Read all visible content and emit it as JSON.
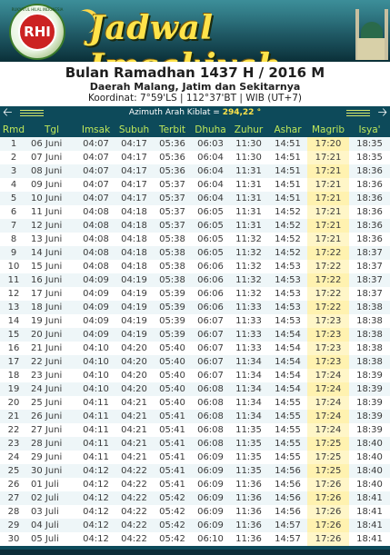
{
  "header": {
    "logo_text": "RHI",
    "logo_ring_text": "RUKYATUL HILAL INDONESIA",
    "brand": "Jadwal Imsakiyah"
  },
  "titlebox": {
    "title": "Bulan Ramadhan 1437 H / 2016 M",
    "subtitle": "Daerah Malang, Jatim dan Sekitarnya",
    "coords": "Koordinat: 7°59'LS | 112°37'BT | WIB (UT+7)"
  },
  "kiblat": {
    "label": "Azimuth Arah Kiblat = ",
    "value": "294,22 °"
  },
  "table": {
    "headers": [
      "Rmd",
      "Tgl",
      "Imsak",
      "Subuh",
      "Terbit",
      "Dhuha",
      "Zuhur",
      "Ashar",
      "Magrib",
      "Isya'"
    ],
    "rows": [
      [
        "1",
        "06 Juni",
        "04:07",
        "04:17",
        "05:36",
        "06:03",
        "11:30",
        "14:51",
        "17:20",
        "18:35"
      ],
      [
        "2",
        "07 Juni",
        "04:07",
        "04:17",
        "05:36",
        "06:04",
        "11:30",
        "14:51",
        "17:21",
        "18:35"
      ],
      [
        "3",
        "08 Juni",
        "04:07",
        "04:17",
        "05:36",
        "06:04",
        "11:31",
        "14:51",
        "17:21",
        "18:36"
      ],
      [
        "4",
        "09 Juni",
        "04:07",
        "04:17",
        "05:37",
        "06:04",
        "11:31",
        "14:51",
        "17:21",
        "18:36"
      ],
      [
        "5",
        "10 Juni",
        "04:07",
        "04:17",
        "05:37",
        "06:04",
        "11:31",
        "14:51",
        "17:21",
        "18:36"
      ],
      [
        "6",
        "11 Juni",
        "04:08",
        "04:18",
        "05:37",
        "06:05",
        "11:31",
        "14:52",
        "17:21",
        "18:36"
      ],
      [
        "7",
        "12 Juni",
        "04:08",
        "04:18",
        "05:37",
        "06:05",
        "11:31",
        "14:52",
        "17:21",
        "18:36"
      ],
      [
        "8",
        "13 Juni",
        "04:08",
        "04:18",
        "05:38",
        "06:05",
        "11:32",
        "14:52",
        "17:21",
        "18:36"
      ],
      [
        "9",
        "14 Juni",
        "04:08",
        "04:18",
        "05:38",
        "06:05",
        "11:32",
        "14:52",
        "17:22",
        "18:37"
      ],
      [
        "10",
        "15 Juni",
        "04:08",
        "04:18",
        "05:38",
        "06:06",
        "11:32",
        "14:53",
        "17:22",
        "18:37"
      ],
      [
        "11",
        "16 Juni",
        "04:09",
        "04:19",
        "05:38",
        "06:06",
        "11:32",
        "14:53",
        "17:22",
        "18:37"
      ],
      [
        "12",
        "17 Juni",
        "04:09",
        "04:19",
        "05:39",
        "06:06",
        "11:32",
        "14:53",
        "17:22",
        "18:37"
      ],
      [
        "13",
        "18 Juni",
        "04:09",
        "04:19",
        "05:39",
        "06:06",
        "11:33",
        "14:53",
        "17:22",
        "18:38"
      ],
      [
        "14",
        "19 Juni",
        "04:09",
        "04:19",
        "05:39",
        "06:07",
        "11:33",
        "14:53",
        "17:23",
        "18:38"
      ],
      [
        "15",
        "20 Juni",
        "04:09",
        "04:19",
        "05:39",
        "06:07",
        "11:33",
        "14:54",
        "17:23",
        "18:38"
      ],
      [
        "16",
        "21 Juni",
        "04:10",
        "04:20",
        "05:40",
        "06:07",
        "11:33",
        "14:54",
        "17:23",
        "18:38"
      ],
      [
        "17",
        "22 Juni",
        "04:10",
        "04:20",
        "05:40",
        "06:07",
        "11:34",
        "14:54",
        "17:23",
        "18:38"
      ],
      [
        "18",
        "23 Juni",
        "04:10",
        "04:20",
        "05:40",
        "06:07",
        "11:34",
        "14:54",
        "17:24",
        "18:39"
      ],
      [
        "19",
        "24 Juni",
        "04:10",
        "04:20",
        "05:40",
        "06:08",
        "11:34",
        "14:54",
        "17:24",
        "18:39"
      ],
      [
        "20",
        "25 Juni",
        "04:11",
        "04:21",
        "05:40",
        "06:08",
        "11:34",
        "14:55",
        "17:24",
        "18:39"
      ],
      [
        "21",
        "26 Juni",
        "04:11",
        "04:21",
        "05:41",
        "06:08",
        "11:34",
        "14:55",
        "17:24",
        "18:39"
      ],
      [
        "22",
        "27 Juni",
        "04:11",
        "04:21",
        "05:41",
        "06:08",
        "11:35",
        "14:55",
        "17:24",
        "18:39"
      ],
      [
        "23",
        "28 Juni",
        "04:11",
        "04:21",
        "05:41",
        "06:08",
        "11:35",
        "14:55",
        "17:25",
        "18:40"
      ],
      [
        "24",
        "29 Juni",
        "04:11",
        "04:21",
        "05:41",
        "06:09",
        "11:35",
        "14:55",
        "17:25",
        "18:40"
      ],
      [
        "25",
        "30 Juni",
        "04:12",
        "04:22",
        "05:41",
        "06:09",
        "11:35",
        "14:56",
        "17:25",
        "18:40"
      ],
      [
        "26",
        "01 Juli",
        "04:12",
        "04:22",
        "05:41",
        "06:09",
        "11:36",
        "14:56",
        "17:26",
        "18:40"
      ],
      [
        "27",
        "02 Juli",
        "04:12",
        "04:22",
        "05:42",
        "06:09",
        "11:36",
        "14:56",
        "17:26",
        "18:41"
      ],
      [
        "28",
        "03 Juli",
        "04:12",
        "04:22",
        "05:42",
        "06:09",
        "11:36",
        "14:56",
        "17:26",
        "18:41"
      ],
      [
        "29",
        "04 Juli",
        "04:12",
        "04:22",
        "05:42",
        "06:09",
        "11:36",
        "14:57",
        "17:26",
        "18:41"
      ],
      [
        "30",
        "05 Juli",
        "04:12",
        "04:22",
        "05:42",
        "06:10",
        "11:36",
        "14:57",
        "17:26",
        "18:41"
      ]
    ]
  },
  "colors": {
    "header_bg": "#0d4a5a",
    "header_text": "#bfe85a",
    "brand_text": "#ffe34a",
    "maghrib_highlight": "#fff6c8",
    "kiblat_value": "#ffe34a"
  },
  "icons": [
    "arrow-left-icon",
    "arrow-right-icon",
    "logo-icon",
    "crescent-icon",
    "mosque-icon"
  ]
}
